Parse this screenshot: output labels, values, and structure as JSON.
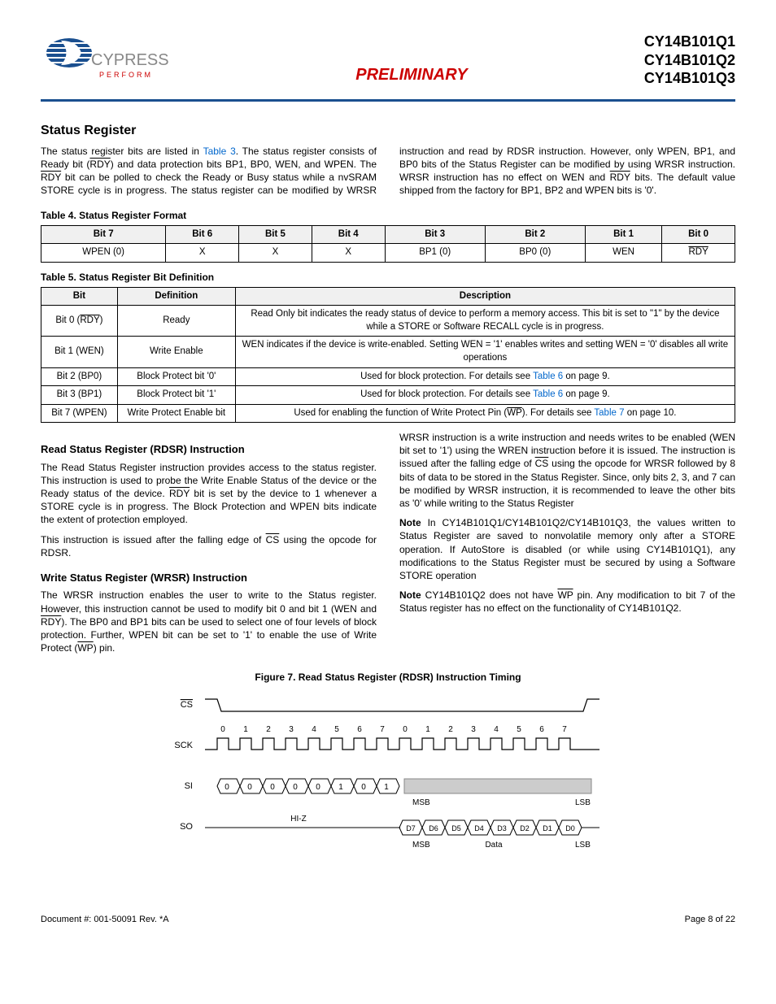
{
  "header": {
    "logo_name": "CYPRESS",
    "logo_tag": "PERFORM",
    "preliminary": "PRELIMINARY",
    "parts": [
      "CY14B101Q1",
      "CY14B101Q2",
      "CY14B101Q3"
    ]
  },
  "section_title": "Status Register",
  "para_intro_a": "The status register bits are listed in ",
  "para_intro_link": "Table 3",
  "para_intro_b": ". The status register consists of Ready bit (",
  "rdy_lbl": "RDY",
  "para_intro_c": ") and data protection bits BP1, BP0, WEN, and WPEN. The ",
  "para_intro_d": " bit can be polled to check the Ready or Busy status while a nvSRAM STORE cycle is in progress. The status register can be modified by WRSR instruction and read by RDSR instruction. However, only WPEN, BP1, and BP0 bits of the Status Register can be modified by using WRSR instruction. WRSR instruction has no effect on WEN and ",
  "para_intro_e": " bits. The default value shipped from the factory for BP1, BP2 and WPEN bits is '0'.",
  "table4": {
    "caption": "Table 4.  Status Register Format",
    "headers": [
      "Bit 7",
      "Bit 6",
      "Bit 5",
      "Bit 4",
      "Bit 3",
      "Bit 2",
      "Bit 1",
      "Bit 0"
    ],
    "row": [
      "WPEN (0)",
      "X",
      "X",
      "X",
      "BP1 (0)",
      "BP0 (0)",
      "WEN",
      "RDY"
    ]
  },
  "table5": {
    "caption": "Table 5.  Status Register Bit Definition",
    "headers": [
      "Bit",
      "Definition",
      "Description"
    ],
    "rows": [
      {
        "bit": "Bit 0 (",
        "bit_ov": "RDY",
        "bit_end": ")",
        "def": "Ready",
        "desc": "Read Only bit indicates the ready status of device to perform a memory access. This bit is set to \"1\" by the device while a STORE or Software RECALL cycle is in progress."
      },
      {
        "bit": "Bit 1 (WEN)",
        "def": "Write Enable",
        "desc": "WEN indicates if the device is write-enabled. Setting WEN = '1' enables writes and setting WEN = '0' disables all write operations"
      },
      {
        "bit": "Bit 2 (BP0)",
        "def": "Block Protect bit '0'",
        "desc_a": "Used for block protection. For details see ",
        "desc_link": "Table 6",
        "desc_b": " on page 9."
      },
      {
        "bit": "Bit 3 (BP1)",
        "def": "Block Protect bit '1'",
        "desc_a": "Used for block protection. For details see ",
        "desc_link": "Table 6",
        "desc_b": " on page 9."
      },
      {
        "bit": "Bit 7 (WPEN)",
        "def": "Write Protect Enable bit",
        "desc_a": "Used for enabling the function of Write Protect Pin (",
        "desc_ov": "WP",
        "desc_mid": "). For details see ",
        "desc_link": "Table 7",
        "desc_b": " on page 10."
      }
    ]
  },
  "rdsr": {
    "heading": "Read Status Register (RDSR) Instruction",
    "p1a": "The Read Status Register instruction provides access to the status register. This instruction is used to probe the Write Enable Status of the device or the Ready status of the device. ",
    "p1b": " bit is set by the device to 1 whenever a STORE cycle is in progress. The Block Protection and WPEN bits indicate the extent of protection employed.",
    "p2a": "This instruction is issued after the falling edge of ",
    "cs": "CS",
    "p2b": " using the opcode for RDSR."
  },
  "wrsr": {
    "heading": "Write Status Register (WRSR) Instruction",
    "p1a": "The WRSR instruction enables the user to write to the Status register. However, this instruction cannot be used to modify bit 0 and bit 1 (WEN and ",
    "p1b": "). The BP0 and BP1 bits can be used to select one of four levels of block protection. Further, WPEN bit can be set to '1' to enable the use of Write Protect (",
    "wp": "WP",
    "p1c": ") pin.",
    "p2a": "WRSR instruction is a write instruction and needs writes to be enabled (WEN bit set to '1') using the WREN instruction before it is issued. The instruction is issued after the falling edge of ",
    "p2b": " using the opcode for WRSR followed by 8 bits of data to be stored in the Status Register. Since, only bits 2, 3, and 7 can be modified by WRSR instruction, it is recommended to leave the other bits as '0' while writing to the Status Register",
    "note1a": "Note",
    "note1b": " In CY14B101Q1/CY14B101Q2/CY14B101Q3, the values written to Status Register are saved to nonvolatile memory only after a STORE operation. If AutoStore is disabled (or while using CY14B101Q1), any modifications to the Status Register must be secured by using a Software STORE operation",
    "note2a": "Note",
    "note2b": " CY14B101Q2 does not have ",
    "note2c": " pin. Any modification to bit 7 of the Status register has no effect on the functionality of CY14B101Q2."
  },
  "figure": {
    "caption": "Figure 7.  Read Status Register (RDSR) Instruction Timing",
    "signals": {
      "cs": "CS",
      "sck": "SCK",
      "si": "SI",
      "so": "SO"
    },
    "clock_labels": [
      "0",
      "1",
      "2",
      "3",
      "4",
      "5",
      "6",
      "7",
      "0",
      "1",
      "2",
      "3",
      "4",
      "5",
      "6",
      "7"
    ],
    "si_bits": [
      "0",
      "0",
      "0",
      "0",
      "0",
      "1",
      "0",
      "1"
    ],
    "so_bits": [
      "D7",
      "D6",
      "D5",
      "D4",
      "D3",
      "D2",
      "D1",
      "D0"
    ],
    "hiz": "HI-Z",
    "msb": "MSB",
    "lsb": "LSB",
    "data": "Data"
  },
  "footer": {
    "doc": "Document #: 001-50091 Rev. *A",
    "page": "Page 8 of 22"
  }
}
